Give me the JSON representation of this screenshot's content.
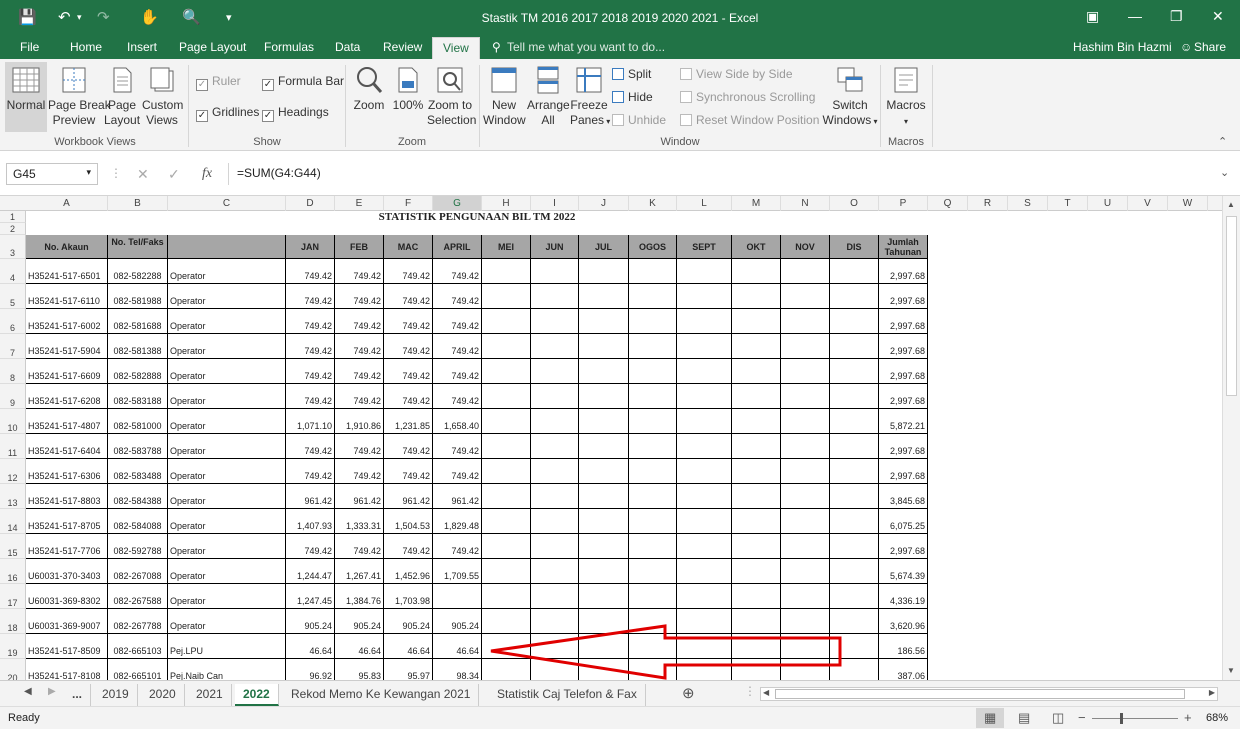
{
  "window": {
    "title": "Stastik TM 2016 2017 2018  2019 2020 2021 - Excel",
    "user": "Hashim Bin Hazmi",
    "share": "Share"
  },
  "ribbon_tabs": [
    "File",
    "Home",
    "Insert",
    "Page Layout",
    "Formulas",
    "Data",
    "Review",
    "View"
  ],
  "active_tab": "View",
  "tell_me": "Tell me what you want to do...",
  "ribbon": {
    "normal": "Normal",
    "page_break": [
      "Page Break",
      "Preview"
    ],
    "page_layout": [
      "Page",
      "Layout"
    ],
    "custom_views": [
      "Custom",
      "Views"
    ],
    "workbook_views": "Workbook Views",
    "ruler": "Ruler",
    "formula_bar": "Formula Bar",
    "gridlines": "Gridlines",
    "headings": "Headings",
    "show": "Show",
    "zoom": "Zoom",
    "zoom100": "100%",
    "zoom_sel": [
      "Zoom to",
      "Selection"
    ],
    "zoom_group": "Zoom",
    "new_window": [
      "New",
      "Window"
    ],
    "arrange_all": [
      "Arrange",
      "All"
    ],
    "freeze": [
      "Freeze",
      "Panes"
    ],
    "split": "Split",
    "hide": "Hide",
    "unhide": "Unhide",
    "view_side": "View Side by Side",
    "sync_scroll": "Synchronous Scrolling",
    "reset_pos": "Reset Window Position",
    "switch": [
      "Switch",
      "Windows"
    ],
    "window_group": "Window",
    "macros": "Macros",
    "macros_group": "Macros"
  },
  "namebox": "G45",
  "formula": "=SUM(G4:G44)",
  "columns": [
    "A",
    "B",
    "C",
    "D",
    "E",
    "F",
    "G",
    "H",
    "I",
    "J",
    "K",
    "L",
    "M",
    "N",
    "O",
    "P",
    "Q",
    "R",
    "S",
    "T",
    "U",
    "V",
    "W"
  ],
  "sheet": {
    "title": "STATISTIK PENGUNAAN BIL TM 2022",
    "headers": [
      "No. Akaun",
      "No. Tel/Faks",
      "",
      "JAN",
      "FEB",
      "MAC",
      "APRIL",
      "MEI",
      "JUN",
      "JUL",
      "OGOS",
      "SEPT",
      "OKT",
      "NOV",
      "DIS",
      "Jumlah Tahunan"
    ],
    "rows": [
      [
        "H35241-517-6501",
        "082-582288",
        "Operator",
        "749.42",
        "749.42",
        "749.42",
        "749.42",
        "2,997.68"
      ],
      [
        "H35241-517-6110",
        "082-581988",
        "Operator",
        "749.42",
        "749.42",
        "749.42",
        "749.42",
        "2,997.68"
      ],
      [
        "H35241-517-6002",
        "082-581688",
        "Operator",
        "749.42",
        "749.42",
        "749.42",
        "749.42",
        "2,997.68"
      ],
      [
        "H35241-517-5904",
        "082-581388",
        "Operator",
        "749.42",
        "749.42",
        "749.42",
        "749.42",
        "2,997.68"
      ],
      [
        "H35241-517-6609",
        "082-582888",
        "Operator",
        "749.42",
        "749.42",
        "749.42",
        "749.42",
        "2,997.68"
      ],
      [
        "H35241-517-6208",
        "082-583188",
        "Operator",
        "749.42",
        "749.42",
        "749.42",
        "749.42",
        "2,997.68"
      ],
      [
        "H35241-517-4807",
        "082-581000",
        "Operator",
        "1,071.10",
        "1,910.86",
        "1,231.85",
        "1,658.40",
        "5,872.21"
      ],
      [
        "H35241-517-6404",
        "082-583788",
        "Operator",
        "749.42",
        "749.42",
        "749.42",
        "749.42",
        "2,997.68"
      ],
      [
        "H35241-517-6306",
        "082-583488",
        "Operator",
        "749.42",
        "749.42",
        "749.42",
        "749.42",
        "2,997.68"
      ],
      [
        "H35241-517-8803",
        "082-584388",
        "Operator",
        "961.42",
        "961.42",
        "961.42",
        "961.42",
        "3,845.68"
      ],
      [
        "H35241-517-8705",
        "082-584088",
        "Operator",
        "1,407.93",
        "1,333.31",
        "1,504.53",
        "1,829.48",
        "6,075.25"
      ],
      [
        "H35241-517-7706",
        "082-592788",
        "Operator",
        "749.42",
        "749.42",
        "749.42",
        "749.42",
        "2,997.68"
      ],
      [
        "U60031-370-3403",
        "082-267088",
        "Operator",
        "1,244.47",
        "1,267.41",
        "1,452.96",
        "1,709.55",
        "5,674.39"
      ],
      [
        "U60031-369-8302",
        "082-267588",
        "Operator",
        "1,247.45",
        "1,384.76",
        "1,703.98",
        "",
        "4,336.19"
      ],
      [
        "U60031-369-9007",
        "082-267788",
        "Operator",
        "905.24",
        "905.24",
        "905.24",
        "905.24",
        "3,620.96"
      ],
      [
        "H35241-517-8509",
        "082-665103",
        "Pej.LPU",
        "46.64",
        "46.64",
        "46.64",
        "46.64",
        "186.56"
      ],
      [
        "H35241-517-8108",
        "082-665101",
        "Pej.Naib Can",
        "96.92",
        "95.83",
        "95.97",
        "98.34",
        "387.06"
      ]
    ]
  },
  "sheet_tabs": [
    "...",
    "2019",
    "2020",
    "2021",
    "2022",
    "Rekod Memo Ke Kewangan 2021",
    "Statistik Caj Telefon & Fax"
  ],
  "active_sheet": "2022",
  "status": {
    "ready": "Ready",
    "zoom": "68%"
  },
  "colors": {
    "excel_green": "#217346",
    "arrow_red": "#e00000",
    "header_grey": "#a6a6a6"
  }
}
